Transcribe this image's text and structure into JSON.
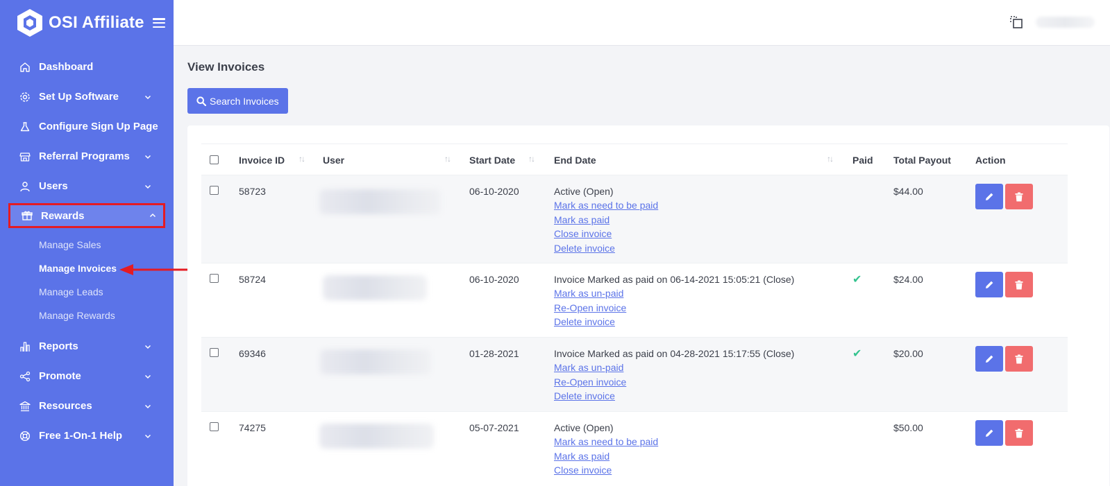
{
  "brand": {
    "name": "OSI Affiliate"
  },
  "sidebar": {
    "items": [
      {
        "label": "Dashboard",
        "icon": "home-icon",
        "has_chevron": false
      },
      {
        "label": "Set Up Software",
        "icon": "gear-icon",
        "has_chevron": true
      },
      {
        "label": "Configure Sign Up Page",
        "icon": "flask-icon",
        "has_chevron": false
      },
      {
        "label": "Referral Programs",
        "icon": "store-icon",
        "has_chevron": true
      },
      {
        "label": "Users",
        "icon": "user-icon",
        "has_chevron": true
      },
      {
        "label": "Rewards",
        "icon": "gift-icon",
        "has_chevron": true,
        "expanded": true
      },
      {
        "label": "Reports",
        "icon": "bar-chart-icon",
        "has_chevron": true
      },
      {
        "label": "Promote",
        "icon": "share-icon",
        "has_chevron": true
      },
      {
        "label": "Resources",
        "icon": "bank-icon",
        "has_chevron": true
      },
      {
        "label": "Free 1-On-1 Help",
        "icon": "lifebuoy-icon",
        "has_chevron": true
      }
    ],
    "rewards_sub": [
      {
        "label": "Manage Sales"
      },
      {
        "label": "Manage Invoices",
        "current": true
      },
      {
        "label": "Manage Leads"
      },
      {
        "label": "Manage Rewards"
      }
    ]
  },
  "page": {
    "title": "View Invoices",
    "search_button": "Search Invoices"
  },
  "table": {
    "headers": {
      "invoice_id": "Invoice ID",
      "user": "User",
      "start_date": "Start Date",
      "end_date": "End Date",
      "paid": "Paid",
      "total_payout": "Total Payout",
      "action": "Action"
    },
    "rows": [
      {
        "id": "58723",
        "start": "06-10-2020",
        "status": "Active (Open)",
        "links": [
          "Mark as need to be paid",
          "Mark as paid",
          "Close invoice",
          "Delete invoice"
        ],
        "paid": false,
        "total": "$44.00"
      },
      {
        "id": "58724",
        "start": "06-10-2020",
        "status": "Invoice Marked as paid on 06-14-2021 15:05:21 (Close)",
        "links": [
          "Mark as un-paid",
          "Re-Open invoice",
          "Delete invoice"
        ],
        "paid": true,
        "total": "$24.00"
      },
      {
        "id": "69346",
        "start": "01-28-2021",
        "status": "Invoice Marked as paid on 04-28-2021 15:17:55 (Close)",
        "links": [
          "Mark as un-paid",
          "Re-Open invoice",
          "Delete invoice"
        ],
        "paid": true,
        "total": "$20.00"
      },
      {
        "id": "74275",
        "start": "05-07-2021",
        "status": "Active (Open)",
        "links": [
          "Mark as need to be paid",
          "Mark as paid",
          "Close invoice"
        ],
        "paid": false,
        "total": "$50.00"
      }
    ]
  },
  "colors": {
    "sidebar": "#5b73e8",
    "highlight_box": "#e41b23",
    "paid_check": "#34c38f",
    "delete_button": "#f16c6e"
  }
}
